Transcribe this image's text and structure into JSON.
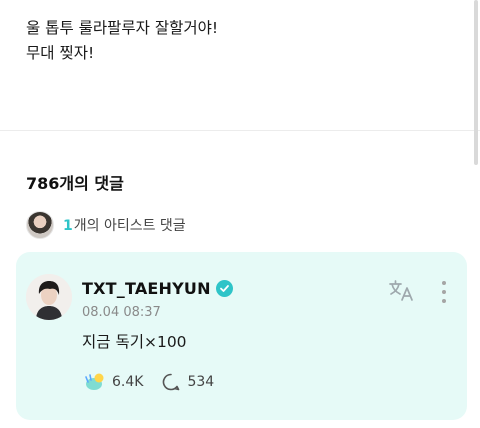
{
  "post": {
    "line1": "울 톱투 룰라팔루자 잘할거야!",
    "line2": "무대 찢자!"
  },
  "comments": {
    "count_label": "786개의 댓글",
    "artist_count": "1",
    "artist_label": "개의 아티스트 댓글"
  },
  "comment": {
    "username": "TXT_TAEHYUN",
    "timestamp": "08.04 08:37",
    "body": "지금 독기×100",
    "likes": "6.4K",
    "replies": "534"
  },
  "colors": {
    "accent": "#2ec4c8",
    "card_bg": "#e6faf7"
  },
  "icons": [
    "verified-icon",
    "translate-icon",
    "more-icon",
    "cheer-icon",
    "reply-icon"
  ]
}
